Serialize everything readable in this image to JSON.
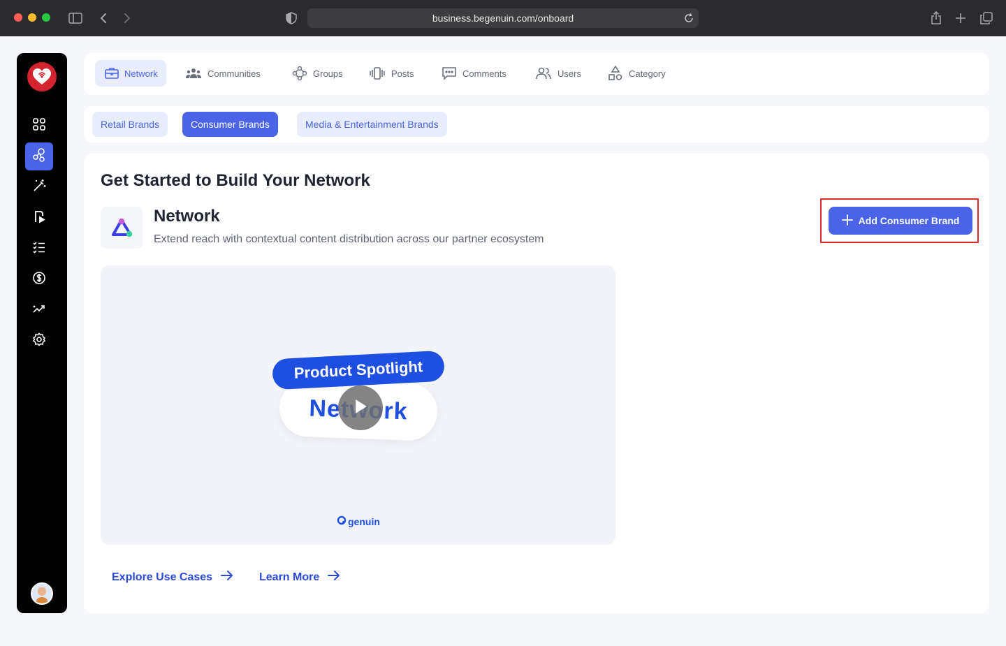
{
  "browser": {
    "url": "business.begenuin.com/onboard",
    "traffic_colors": [
      "#ff5f57",
      "#febc2e",
      "#28c840"
    ]
  },
  "sidebar": {
    "items": [
      {
        "icon": "grid-icon",
        "active": false
      },
      {
        "icon": "network-icon",
        "active": true
      },
      {
        "icon": "magic-wand-icon",
        "active": false
      },
      {
        "icon": "video-file-icon",
        "active": false
      },
      {
        "icon": "checklist-icon",
        "active": false
      },
      {
        "icon": "dollar-icon",
        "active": false
      },
      {
        "icon": "analytics-icon",
        "active": false
      },
      {
        "icon": "settings-icon",
        "active": false
      }
    ]
  },
  "nav": {
    "tabs": [
      {
        "label": "Network",
        "icon": "briefcase-icon",
        "active": true
      },
      {
        "label": "Communities",
        "icon": "people-group-icon",
        "active": false
      },
      {
        "label": "Groups",
        "icon": "groups-icon",
        "active": false
      },
      {
        "label": "Posts",
        "icon": "posts-icon",
        "active": false
      },
      {
        "label": "Comments",
        "icon": "comment-icon",
        "active": false
      },
      {
        "label": "Users",
        "icon": "users-icon",
        "active": false
      },
      {
        "label": "Category",
        "icon": "category-icon",
        "active": false
      }
    ]
  },
  "brands": {
    "pills": [
      {
        "label": "Retail Brands",
        "active": false
      },
      {
        "label": "Consumer Brands",
        "active": true
      },
      {
        "label": "Media & Entertainment Brands",
        "active": false
      }
    ]
  },
  "main": {
    "title": "Get Started to Build Your Network",
    "section_title": "Network",
    "section_desc": "Extend reach with contextual content distribution across our partner ecosystem",
    "add_button": "Add Consumer Brand",
    "video": {
      "banner": "Product Spotlight",
      "headline": "Network",
      "brand": "genuin"
    },
    "links": {
      "explore": "Explore Use Cases",
      "learn": "Learn More"
    }
  },
  "colors": {
    "accent": "#4a63e7",
    "highlight": "#d92d2d"
  }
}
